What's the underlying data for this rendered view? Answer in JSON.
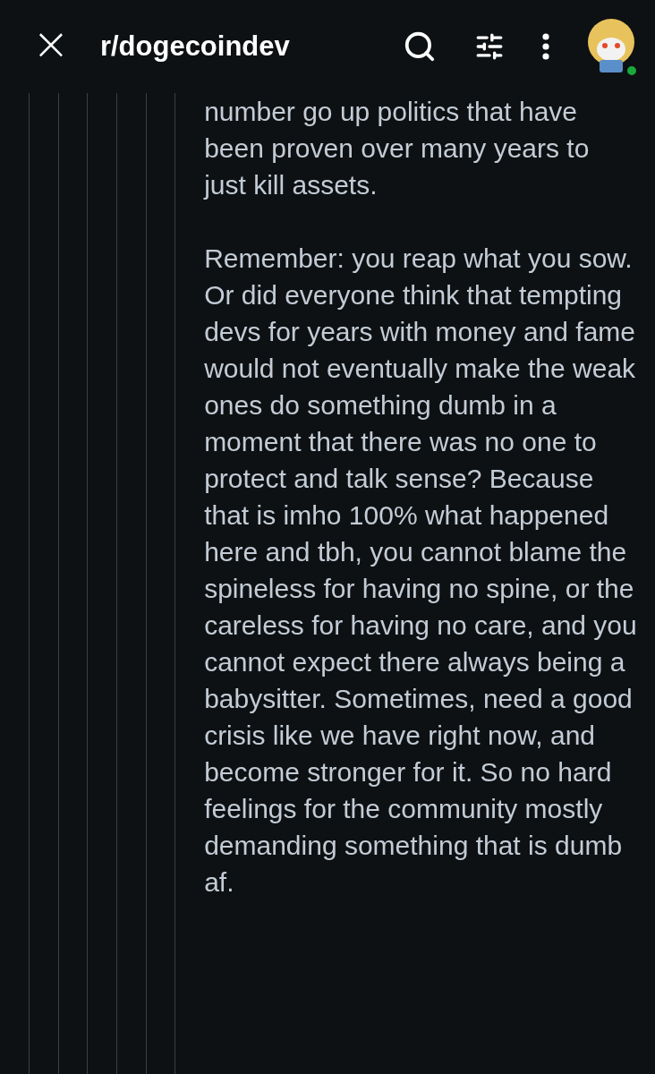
{
  "header": {
    "close": "×",
    "title": "r/dogecoindev",
    "avatar": {
      "online": true
    }
  },
  "paragraphs": [
    "number go up politics that have been proven over many years to just kill assets.",
    "Remember: you reap what you sow. Or did everyone think that tempting devs for years with money and fame would not eventually make the weak ones do something dumb in a moment that there was no one to protect and talk sense? Because that is imho 100% what happened here and tbh, you cannot blame the spineless for having no spine, or the careless for having no care, and you cannot expect there always being a babysitter. Sometimes, need a good crisis like we have right now, and become stronger for it. So no hard feelings for the community mostly demanding something that is dumb af."
  ]
}
